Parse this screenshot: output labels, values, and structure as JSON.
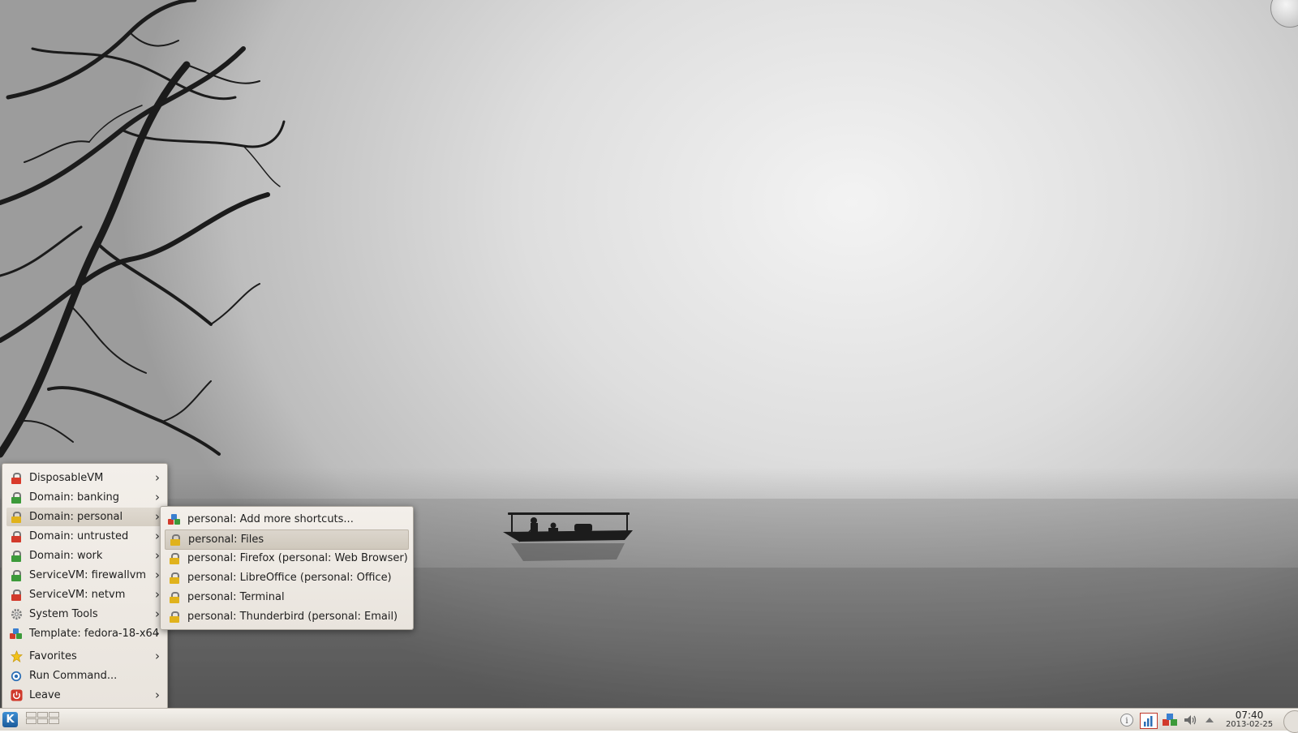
{
  "main_menu": {
    "items": [
      {
        "label": "DisposableVM",
        "icon": "disposable-vm-lock-icon",
        "color": "#d93b2b",
        "submenu": true
      },
      {
        "label": "Domain: banking",
        "icon": "green-lock-icon",
        "color": "#3c9a3a",
        "submenu": true
      },
      {
        "label": "Domain: personal",
        "icon": "yellow-lock-icon",
        "color": "#e0b21c",
        "submenu": true,
        "highlighted": true
      },
      {
        "label": "Domain: untrusted",
        "icon": "red-lock-icon",
        "color": "#d23a2b",
        "submenu": true
      },
      {
        "label": "Domain: work",
        "icon": "green-lock-icon",
        "color": "#3c9a3a",
        "submenu": true
      },
      {
        "label": "ServiceVM: firewallvm",
        "icon": "green-lock-icon",
        "color": "#3c9a3a",
        "submenu": true
      },
      {
        "label": "ServiceVM: netvm",
        "icon": "red-lock-icon",
        "color": "#d23a2b",
        "submenu": true
      },
      {
        "label": "System Tools",
        "icon": "gear-icon",
        "color": "#8a8a8a",
        "submenu": true
      },
      {
        "label": "Template: fedora-18-x64",
        "icon": "qubes-template-icon",
        "color": "#3a7fd0",
        "submenu": true
      },
      {
        "label": "Favorites",
        "icon": "star-icon",
        "color": "#f2c21a",
        "submenu": true
      },
      {
        "label": "Run Command...",
        "icon": "run-command-icon",
        "color": "#2d6fb5",
        "submenu": false
      },
      {
        "label": "Leave",
        "icon": "power-icon",
        "color": "#d0392b",
        "submenu": true
      }
    ]
  },
  "sub_menu": {
    "items": [
      {
        "label": "personal: Add more shortcuts...",
        "icon": "qubes-manager-icon"
      },
      {
        "label": "personal: Files",
        "icon": "yellow-lock-icon",
        "selected": true
      },
      {
        "label": "personal: Firefox (personal: Web Browser)",
        "icon": "yellow-lock-icon"
      },
      {
        "label": "personal: LibreOffice (personal: Office)",
        "icon": "yellow-lock-icon"
      },
      {
        "label": "personal: Terminal",
        "icon": "yellow-lock-icon"
      },
      {
        "label": "personal: Thunderbird (personal: Email)",
        "icon": "yellow-lock-icon"
      }
    ]
  },
  "taskbar": {
    "launcher_icon": "kde-launcher-icon",
    "clock_time": "07:40",
    "clock_date": "2013-02-25",
    "tray_icons": [
      "notifications-info-icon",
      "network-monitor-icon",
      "qubes-manager-icon",
      "volume-icon",
      "tray-expand-arrow-icon"
    ]
  },
  "colors": {
    "menu_bg": "#ece7e0",
    "highlight": "#d5cec3",
    "lock_yellow": "#e0b21c",
    "lock_green": "#3c9a3a",
    "lock_red": "#d23a2b"
  }
}
